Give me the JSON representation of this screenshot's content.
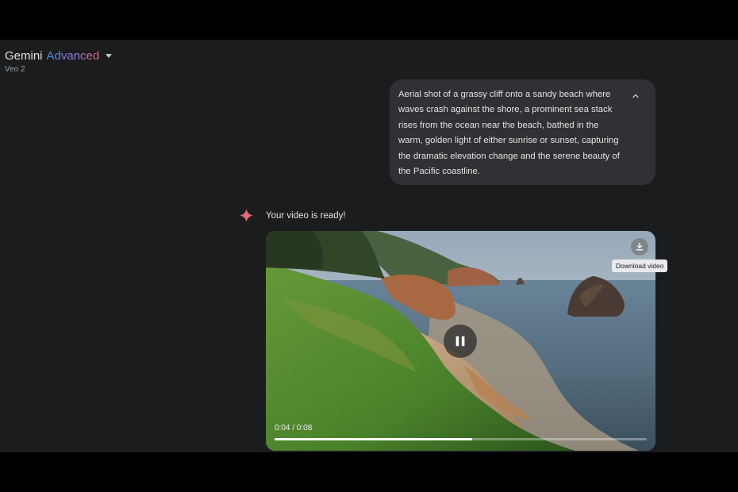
{
  "header": {
    "app_name": "Gemini",
    "tier": "Advanced",
    "model": "Veo 2",
    "dropdown_icon": "caret-down-icon"
  },
  "prompt": {
    "text": "Aerial shot of a grassy cliff onto a sandy beach where waves crash against the shore, a prominent sea stack rises from the ocean near the beach, bathed in the warm, golden light of either sunrise or sunset, capturing the dramatic elevation change and the serene beauty of the Pacific coastline.",
    "collapse_icon": "chevron-up-icon"
  },
  "response": {
    "icon": "gemini-sparkle-icon",
    "text": "Your video is ready!"
  },
  "video": {
    "time": "0:04 / 0:08",
    "progress": 0.53,
    "pause_icon": "pause-icon",
    "download_icon": "download-icon",
    "download_tooltip": "Download video"
  },
  "colors": {
    "background": "#1b1c1d",
    "bubble": "#303134",
    "sparkle": "#e36a75"
  }
}
